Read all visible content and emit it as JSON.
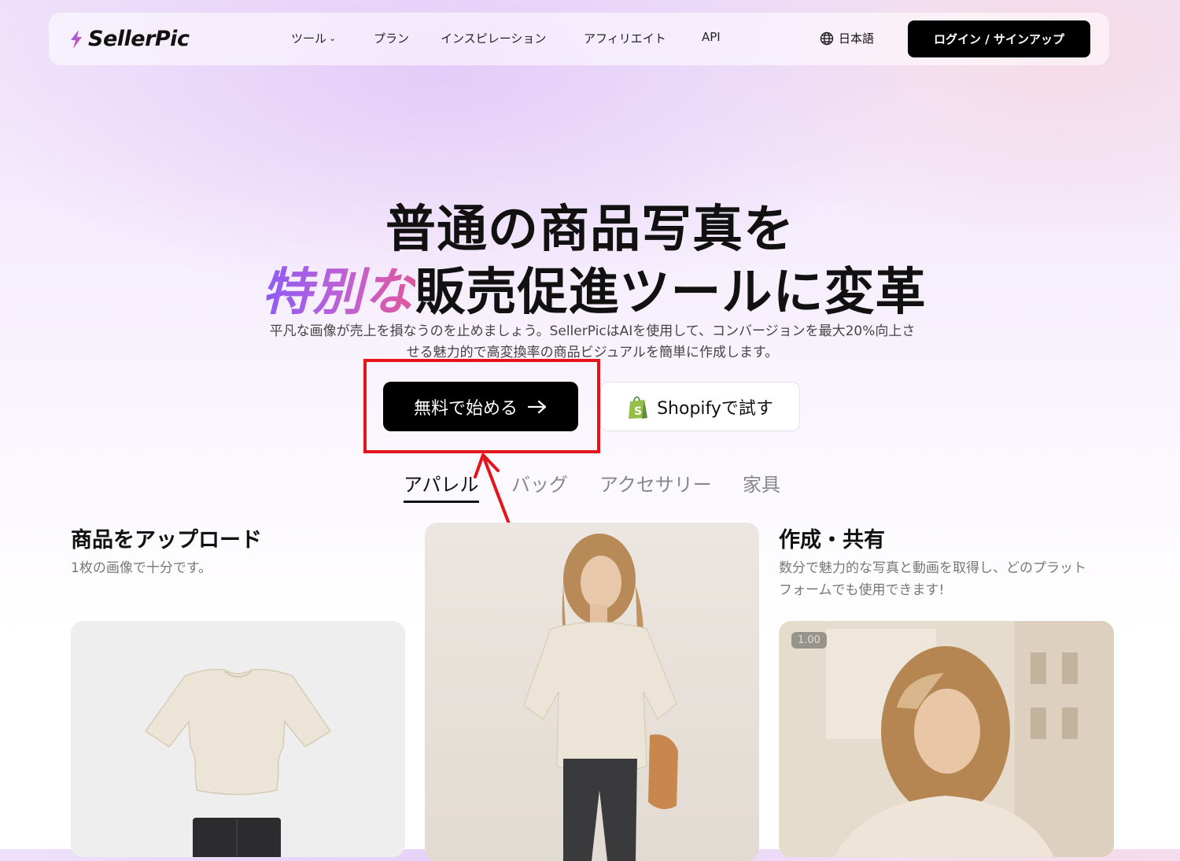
{
  "nav": {
    "logo": "SellerPic",
    "links": [
      {
        "label": "ツール",
        "has_dropdown": true
      },
      {
        "label": "プラン"
      },
      {
        "label": "インスピレーション"
      },
      {
        "label": "アフィリエイト"
      },
      {
        "label": "API"
      }
    ],
    "language": "日本語",
    "login_label": "ログイン / サインアップ"
  },
  "hero": {
    "line1": "普通の商品写真を",
    "line2_highlight": "特別な",
    "line2_rest": "販売促進ツールに変革",
    "subtitle_line1": "平凡な画像が売上を損なうのを止めましょう。SellerPicはAIを使用して、コンバージョンを最大20%向上さ",
    "subtitle_line2": "せる魅力的で高変換率の商品ビジュアルを簡単に作成します。",
    "cta_primary": "無料で始める",
    "cta_shopify": "Shopifyで試す"
  },
  "tabs": [
    "アパレル",
    "バッグ",
    "アクセサリー",
    "家具"
  ],
  "active_tab": 0,
  "columns": {
    "upload": {
      "title": "商品をアップロード",
      "desc": "1枚の画像で十分です。"
    },
    "share": {
      "title": "作成・共有",
      "desc_line1": "数分で魅力的な写真と動画を取得し、どのプラット",
      "desc_line2": "フォームでも使用できます!"
    }
  },
  "video_speed_badge": "1.00",
  "colors": {
    "accent_gradient_start": "#8b5cf6",
    "accent_gradient_end": "#e0569b",
    "annotation_red": "#e5141b",
    "shopify_green": "#95bf47"
  }
}
